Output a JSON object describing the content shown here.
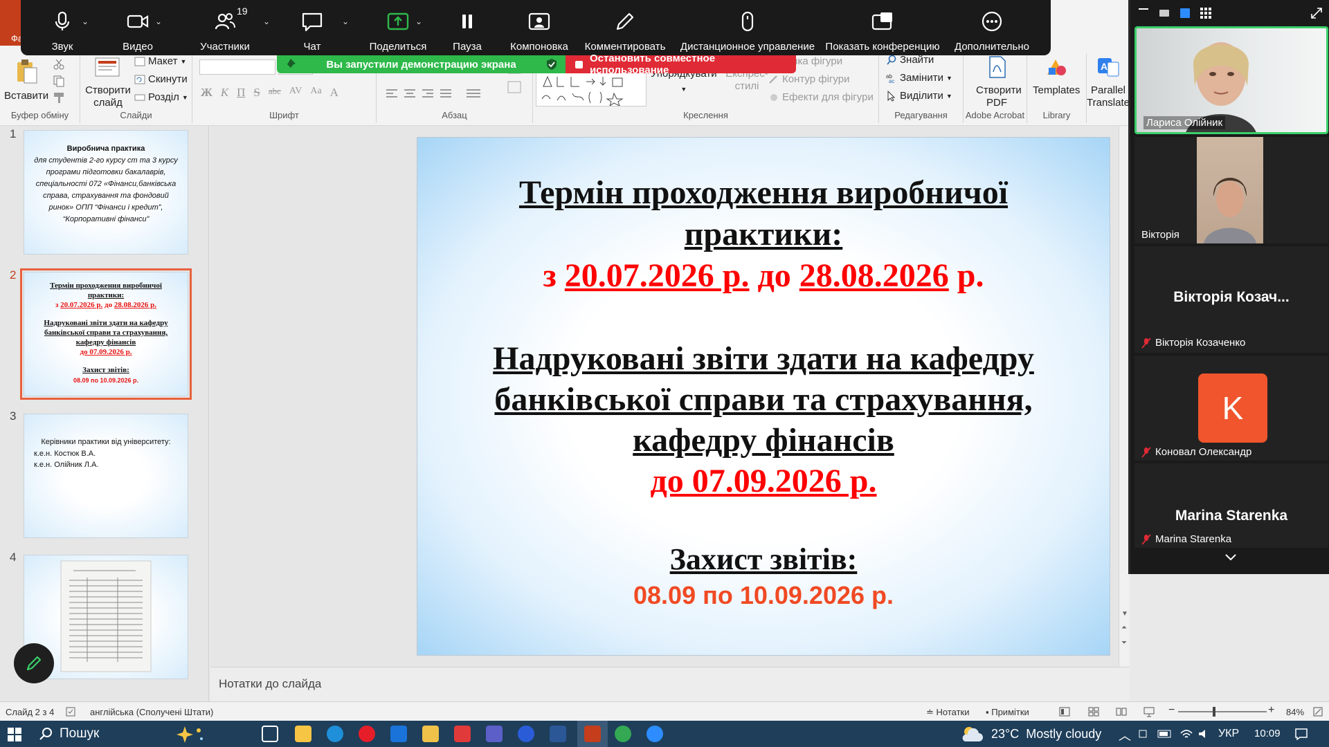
{
  "zoom_toolbar": {
    "audio": "Звук",
    "video": "Видео",
    "participants": "Участники",
    "participants_count": "19",
    "chat": "Чат",
    "share": "Поделиться",
    "pause": "Пауза",
    "layout": "Компоновка",
    "annotate": "Комментировать",
    "remote_control": "Дистанционное управление",
    "show_conference": "Показать конференцию",
    "more": "Дополнительно",
    "share_banner": "Вы запустили демонстрацию экрана",
    "stop_share": "Остановить совместное использование"
  },
  "ribbon": {
    "app_letter": "Фа",
    "paste": "Вставити",
    "clipboard_group": "Буфер обміну",
    "new_slide": "Створити слайд",
    "layout": "Макет",
    "reset": "Скинути",
    "section": "Розділ",
    "slides_group": "Слайди",
    "font_group": "Шрифт",
    "paragraph_group": "Абзац",
    "arrange": "Упорядкувати",
    "quick_styles": "Експрес-стилі",
    "shape_fill": "Заливка фігури",
    "shape_outline": "Контур фігури",
    "shape_effects": "Ефекти для фігури",
    "drawing_group": "Креслення",
    "find": "Знайти",
    "replace": "Замінити",
    "select": "Виділити",
    "editing_group": "Редагування",
    "create_pdf": "Створити PDF",
    "acrobat_group": "Adobe Acrobat",
    "templates": "Templates",
    "library_group": "Library",
    "parallel_translate": "Parallel Translate"
  },
  "thumbnails": [
    {
      "num": "1",
      "title": "Виробнича практика",
      "text": "для студентів 2-го курсу ст та 3 курсу програми підготовки бакалаврів, спеціальності 072 «Фінанси,банківська справа, страхування та фондовий ринок» ОПП “Фінанси і кредит”, “Корпоративні фінанси”"
    },
    {
      "num": "2",
      "l1": "Термін проходження виробничої практики:",
      "l2a": "з ",
      "l2b": "20.07.2026 р.",
      "l2c": " до ",
      "l2d": "28.08.2026 р.",
      "l3": "Надруковані звіти здати на кафедру банківської справи та страхування, кафедру фінансів",
      "l4": "до 07.09.2026 р.",
      "l5": "Захист звітів:",
      "l6": "08.09 по 10.09.2026 р."
    },
    {
      "num": "3",
      "l1": "Керівники практики від університету:",
      "l2": "к.е.н. Костюк В.А.",
      "l3": "к.е.н. Олійник Л.А."
    },
    {
      "num": "4"
    }
  ],
  "slide": {
    "title_1": "Термін проходження виробничої",
    "title_2": "практики:",
    "from": "з ",
    "from_date": "20.07.2026 р.",
    "to": " до ",
    "to_date": "28.08.2026",
    "to_suffix": " р.",
    "reports_1": "Надруковані звіти здати на кафедру",
    "reports_2": "банківської справи та страхування,",
    "reports_3": "кафедру фінансів",
    "deadline": "до 07.09.2026 р.",
    "defense_title": "Захист звітів:",
    "defense_dates": "08.09 по 10.09.2026 р."
  },
  "notes_placeholder": "Нотатки до слайда",
  "status_bar": {
    "slide_info": "Слайд 2 з 4",
    "language": "англійська (Сполучені Штати)",
    "notes": "Нотатки",
    "comments": "Примітки",
    "zoom": "84%"
  },
  "video_panel": {
    "tiles": [
      {
        "name": "Лариса Олійник"
      },
      {
        "name": "Вікторія"
      },
      {
        "big_name": "Вікторія Козач...",
        "name": "Вікторія Козаченко"
      },
      {
        "avatar_letter": "K",
        "name": "Коновал Олександр"
      },
      {
        "big_name": "Marina Starenka",
        "name": "Marina Starenka"
      }
    ]
  },
  "taskbar": {
    "search": "Пошук",
    "weather": "23°C  Mostly cloudy",
    "lang": "УКР",
    "time": "10:09"
  },
  "colors": {
    "accent_ppt": "#c43e1c",
    "share_green": "#2eb94a",
    "stop_red": "#e02a35",
    "slide_red": "#ff0000",
    "avatar_orange": "#f0552d"
  }
}
